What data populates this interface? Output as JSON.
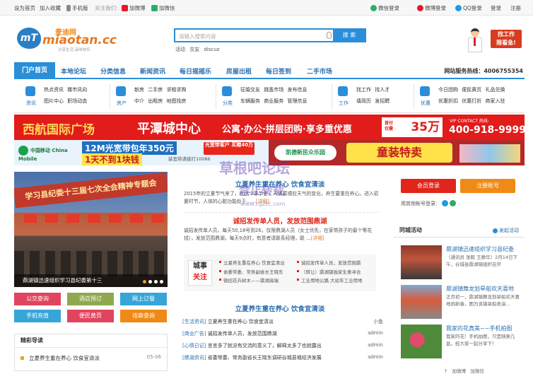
{
  "topbar": {
    "left": [
      "设为首页",
      "加入收藏",
      "手机版",
      "关注我们:",
      "加微博",
      "加微信"
    ],
    "right": [
      "微信登录",
      "微博登录",
      "QQ登录",
      "登录",
      "注册"
    ]
  },
  "logo": {
    "badge": "mT",
    "cn": "麦迪网",
    "en": "miaotan.cc",
    "sub": "分享生活  品味快乐"
  },
  "search": {
    "placeholder": "请输入搜索内容",
    "button": "搜 索",
    "hotwords": "活动 交友 discuz"
  },
  "promo": {
    "text1": "找工作",
    "text2": "限看急!"
  },
  "nav": {
    "items": [
      "门户首页",
      "本地论坛",
      "分类信息",
      "新闻资讯",
      "每日摇摇乐",
      "房屋出租",
      "每日签到",
      "二手市场"
    ],
    "hotline_label": "网站服务热线：",
    "hotline": "4006755354"
  },
  "categories": [
    {
      "label": "资讯",
      "row1": "热点资讯 楼市风向",
      "row2": "图片中心 职场动态"
    },
    {
      "label": "房产",
      "row1": "新房 二手房 求租求购",
      "row2": "中介 出租房 地图找房"
    },
    {
      "label": "分类",
      "row1": "征婚交友 跳蚤市场 发布信息",
      "row2": "车辆服务 商业服务 管理信息"
    },
    {
      "label": "工作",
      "row1": "找工作 找人才",
      "row2": "填简历 发招聘"
    },
    {
      "label": "优惠",
      "row1": "今日团购 便民黄页 礼品兑换",
      "row2": "优惠折扣 优惠打折 商家入驻"
    }
  ],
  "banner1": {
    "t1": "西航国际广场",
    "t2": "平潭城中心",
    "t3": "公寓·办公·拼层团购·享多重优惠",
    "price_label": "首付仅需",
    "price": "35万",
    "hot_label": "VIP CONTACT 热线:",
    "phone": "400-918-9999"
  },
  "banner2": {
    "cm": "中国移动 China Mobile",
    "big1": "12M光宽带包年350元",
    "big2": "1天不到1块钱",
    "small": "装宽带请拨打10086",
    "gb": "光宽带客户 买赠40万",
    "kd": "凯德新民众乐园",
    "tz": "童装特卖"
  },
  "photo": {
    "banner_text": "学习县纪委十三届七次全会精神专题会",
    "caption": "鼎湖镇迅速组织学习县纪委第十三"
  },
  "quick_buttons": [
    "公交查询",
    "酒店预订",
    "网上订餐",
    "手机充值",
    "便民黄页",
    "违章查询"
  ],
  "quick_colors": [
    "#e1445f",
    "#8fa84f",
    "#37a5d8",
    "#37a5d8",
    "#e1445f",
    "#f08a16"
  ],
  "guide": {
    "title": "精彩导读",
    "item": "立夏养生重在养心 饮食宜清淡",
    "date": "05-06"
  },
  "middle": {
    "headline1": "立夏养生重在养心 饮食宜清淡",
    "para1": "2015年的立夏节气来了，在这个季节里，人体要顺应天气的变化，养生要重在养心。进入初夏时节，人体的心脏功能处于……",
    "more": "[详细]",
    "headline2": "诚招发传单人员，发放范围鼎湖",
    "para2": "诚招发传单人员，每天50,18号到26，仅限鼎湖人员（女士优先，在家带孩子的最个零花钱），发放范围鼎湖，每天9点时，有意者请联系经理，联 …",
    "more2": "[详细]",
    "chengshi_tag1": "城事",
    "chengshi_tag2": "关注",
    "cs_left": [
      "立夏养生重在养心 饮食宜清淡",
      "省委常委、常务副省长王晓东",
      "微招花卉树木——鼎湖高端"
    ],
    "cs_right": [
      "诚招发传单人员，发放范围鼎",
      "（转让）鼎湖镇独家生意寻合",
      "工业用地公路.大幼车工业用地"
    ],
    "headline3": "立夏养生重在养心 饮食宜清淡",
    "list": [
      {
        "cat": "[生活资讯]",
        "title": "立夏养生重在养心 饮食宜清淡",
        "user": "小鱼"
      },
      {
        "cat": "[商业广告]",
        "title": "诚招发传单人员，发放范围鼎湖",
        "user": "admin"
      },
      {
        "cat": "[心情日记]",
        "title": "言言多了就没有交流的意义了，解释太多了也就露出",
        "user": "admin"
      },
      {
        "cat": "[鼎湖资讯]",
        "title": "省委常委、常务副省长王晓东调研谷城县城经济发展",
        "user": "admin"
      }
    ]
  },
  "right": {
    "login_btn": "会员登录",
    "reg_btn": "注册账号",
    "login_hint": "用其他帐号登录：",
    "section_title": "同城活动",
    "post_link": "发起活动",
    "activities": [
      {
        "title": "鼎湖镇迅速组织学习县纪委",
        "desc": "（通讯员 张毅 王静华）2月14日下午，谷城县鼎湖镇组织召开"
      },
      {
        "title": "鼎湖镇舞龙划旱船欢天喜地",
        "desc": "正月初一，鼎湖镇舞龙划旱船欢天喜地闹新春，图为该镇旱船表演…"
      },
      {
        "title": "我家的花真美~~手机拍图",
        "desc": "我家的花！手机拍图，只是随意几盆，经大家一起分享下！"
      }
    ]
  },
  "floatbar": [
    "↑",
    "加微博",
    "加微信"
  ],
  "watermark": {
    "l1": "草根吧论坛",
    "l2": "禁止转载",
    "l3": "www.cgzzc.com"
  },
  "colors": {
    "brand_blue": "#2b8ed8",
    "banner_red": "#e21b1b",
    "orange": "#f08a16"
  }
}
